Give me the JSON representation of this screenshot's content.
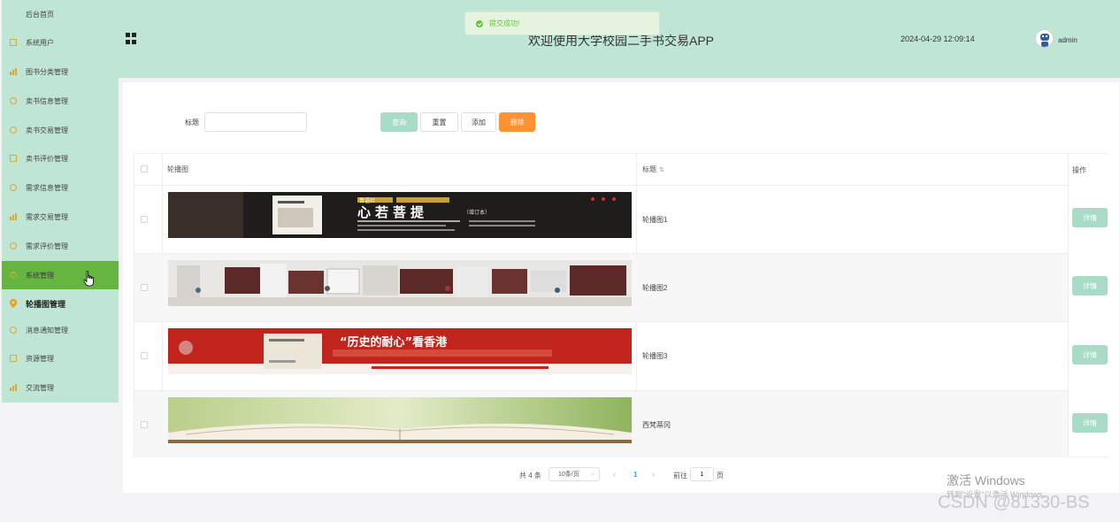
{
  "sidebar": {
    "items": [
      {
        "label": "后台首页"
      },
      {
        "label": "系统用户"
      },
      {
        "label": "图书分类管理"
      },
      {
        "label": "卖书信息管理"
      },
      {
        "label": "卖书交易管理"
      },
      {
        "label": "卖书评价管理"
      },
      {
        "label": "需求信息管理"
      },
      {
        "label": "需求交易管理"
      },
      {
        "label": "需求评价管理"
      },
      {
        "label": "系统管理"
      },
      {
        "label": "轮播图管理"
      },
      {
        "label": "消息通知管理"
      },
      {
        "label": "资源管理"
      },
      {
        "label": "交流管理"
      }
    ]
  },
  "header": {
    "title": "欢迎使用大学校园二手书交易APP",
    "datetime": "2024-04-29 12:09:14",
    "username": "admin"
  },
  "toast": {
    "message": "提交成功!"
  },
  "search": {
    "label": "标题",
    "value": "",
    "query": "查询",
    "reset": "重置",
    "add": "添加",
    "delete": "删除"
  },
  "table": {
    "headers": {
      "image": "轮播图",
      "title": "标题",
      "action": "操作"
    },
    "detail_label": "详情",
    "rows": [
      {
        "title": "轮播图1",
        "banner_text": {
          "top": "晋语社",
          "main": "心若菩提",
          "sub": "（增订本）"
        }
      },
      {
        "title": "轮播图2"
      },
      {
        "title": "轮播图3",
        "banner_text": {
          "main": "“历史的耐心”看香港"
        }
      },
      {
        "title": "西梵蒂冈"
      }
    ]
  },
  "pagination": {
    "total": "共 4 条",
    "page_size": "10条/页",
    "prev": "‹",
    "current_page": "1",
    "next": "›",
    "goto_label": "前往",
    "goto_value": "1",
    "page_suffix": "页"
  },
  "watermark": {
    "windows": "激活 Windows",
    "windows_sub": "转到\"设置\"以激活 Windows。",
    "csdn": "CSDN @81330-BS"
  },
  "colors": {
    "sidebar_bg": "#bfe5d5",
    "active_bg": "#67b541",
    "primary_btn": "#a8dcc6",
    "danger_btn": "#fb9335",
    "toast_text": "#67c23a"
  }
}
